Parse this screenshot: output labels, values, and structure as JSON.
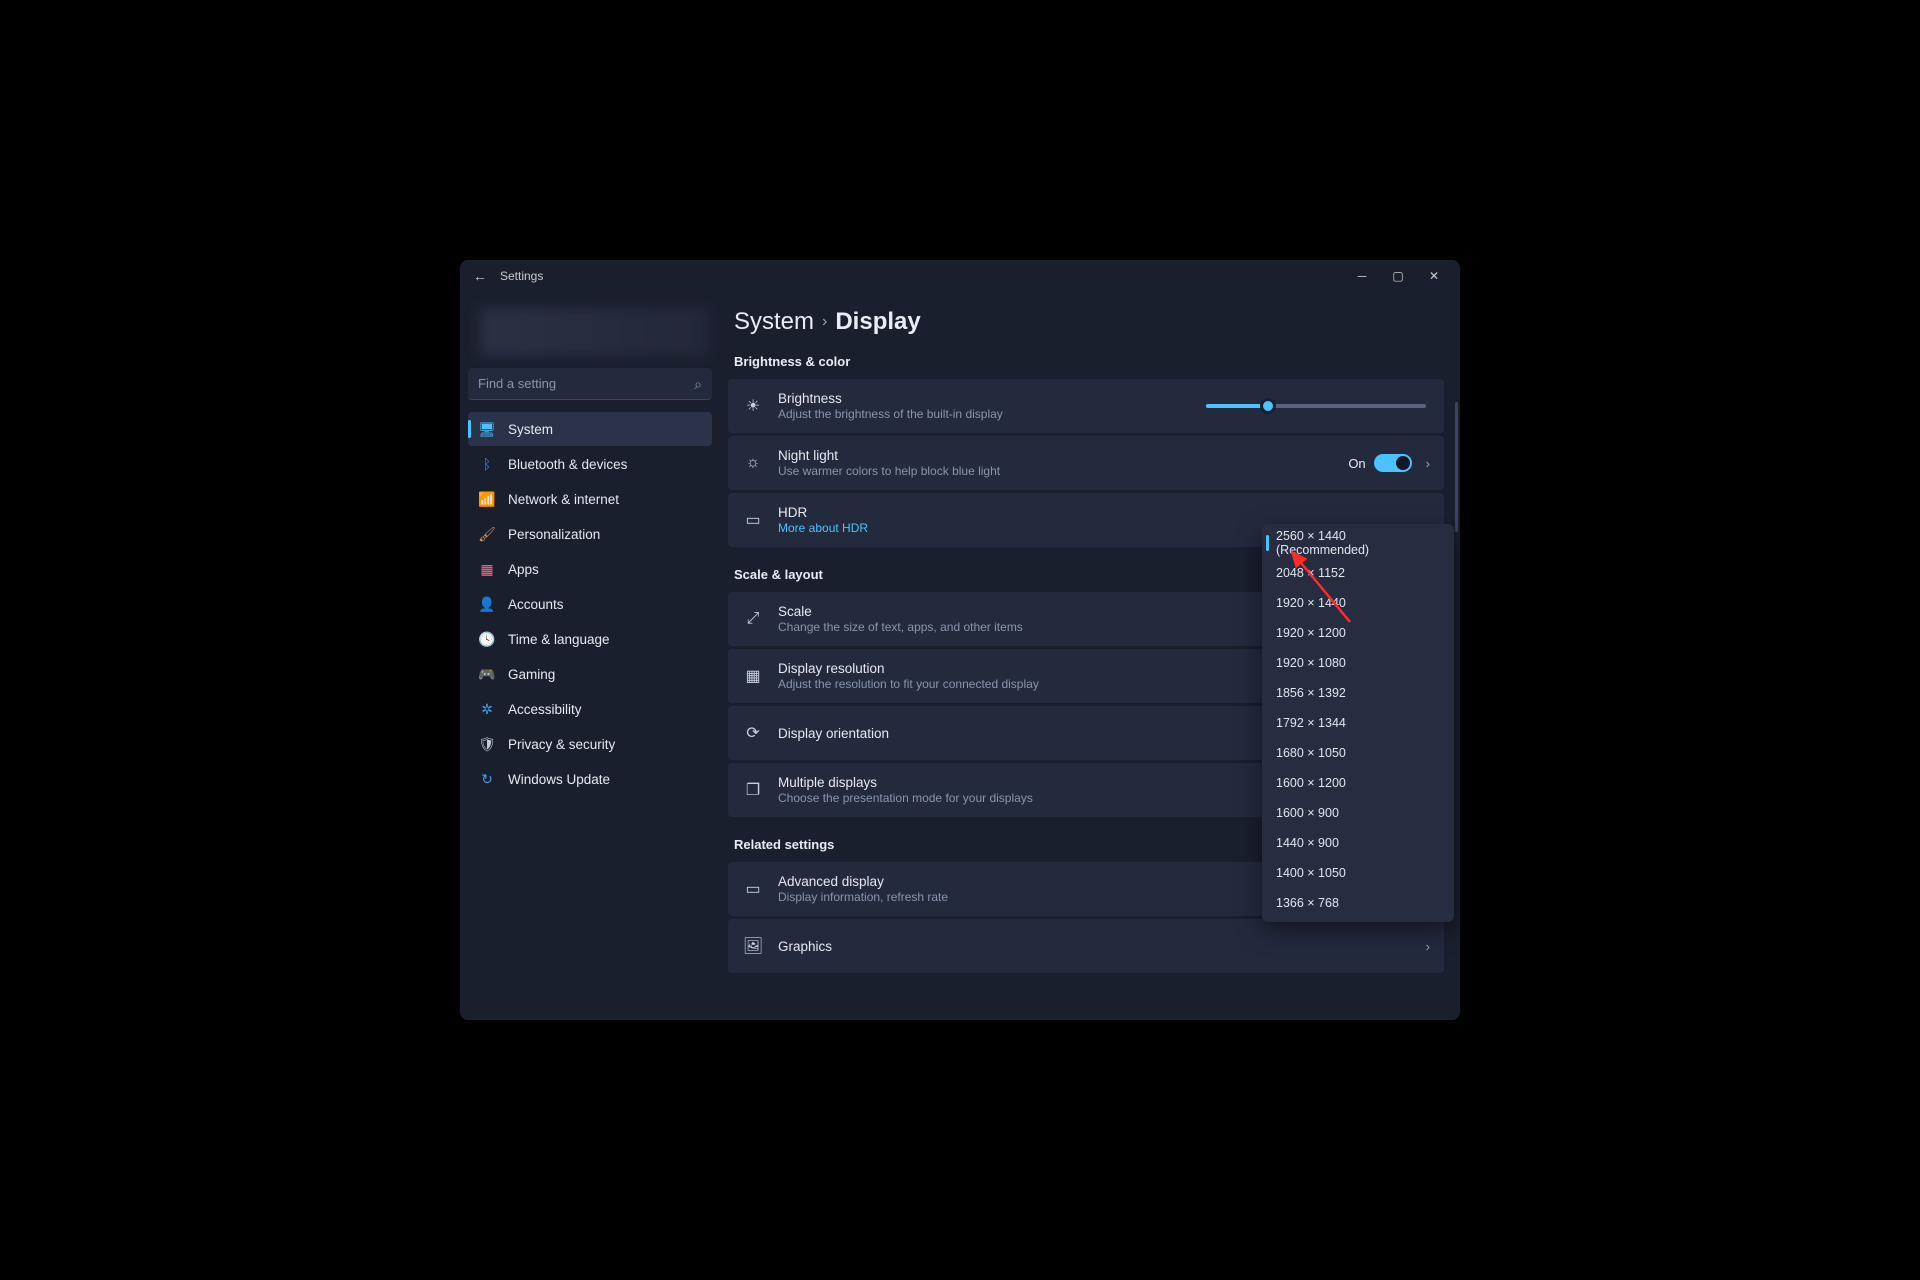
{
  "titlebar": {
    "title": "Settings"
  },
  "search": {
    "placeholder": "Find a setting"
  },
  "nav": {
    "system": "System",
    "bluetooth": "Bluetooth & devices",
    "network": "Network & internet",
    "personalization": "Personalization",
    "apps": "Apps",
    "accounts": "Accounts",
    "time": "Time & language",
    "gaming": "Gaming",
    "accessibility": "Accessibility",
    "privacy": "Privacy & security",
    "update": "Windows Update"
  },
  "breadcrumb": {
    "parent": "System",
    "current": "Display"
  },
  "sections": {
    "brightness": "Brightness & color",
    "scale": "Scale & layout",
    "related": "Related settings"
  },
  "cards": {
    "brightness": {
      "title": "Brightness",
      "sub": "Adjust the brightness of the built-in display"
    },
    "nightlight": {
      "title": "Night light",
      "sub": "Use warmer colors to help block blue light",
      "state": "On"
    },
    "hdr": {
      "title": "HDR",
      "sub": "More about HDR"
    },
    "scale": {
      "title": "Scale",
      "sub": "Change the size of text, apps, and other items"
    },
    "resolution": {
      "title": "Display resolution",
      "sub": "Adjust the resolution to fit your connected display"
    },
    "orientation": {
      "title": "Display orientation"
    },
    "multiple": {
      "title": "Multiple displays",
      "sub": "Choose the presentation mode for your displays"
    },
    "advanced": {
      "title": "Advanced display",
      "sub": "Display information, refresh rate"
    },
    "graphics": {
      "title": "Graphics"
    }
  },
  "resolutions": [
    "2560 × 1440 (Recommended)",
    "2048 × 1152",
    "1920 × 1440",
    "1920 × 1200",
    "1920 × 1080",
    "1856 × 1392",
    "1792 × 1344",
    "1680 × 1050",
    "1600 × 1200",
    "1600 × 900",
    "1440 × 900",
    "1400 × 1050",
    "1366 × 768"
  ]
}
